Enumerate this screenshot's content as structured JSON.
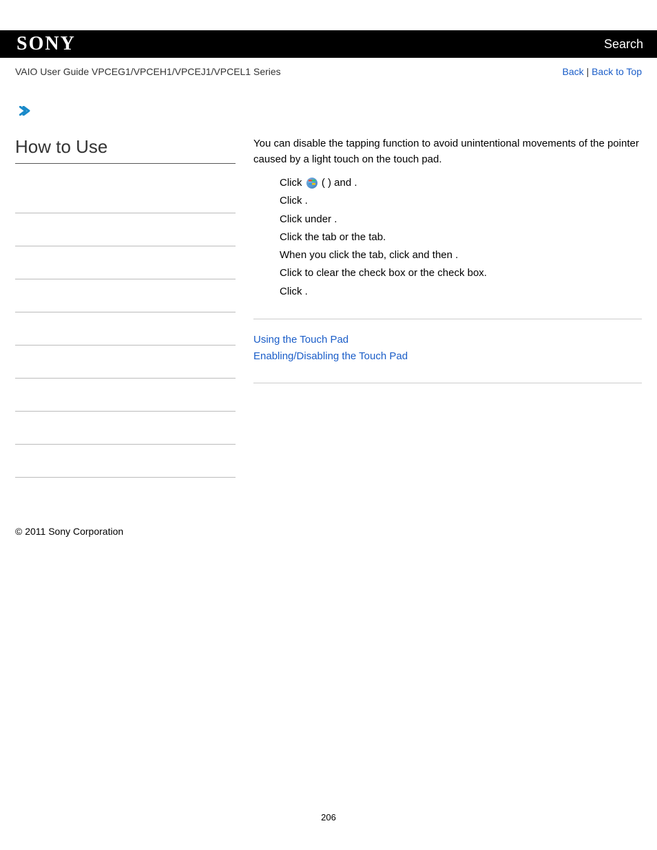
{
  "header": {
    "logo_text": "SONY",
    "search_label": "Search"
  },
  "subbar": {
    "guide_text": "VAIO User Guide VPCEG1/VPCEH1/VPCEJ1/VPCEL1 Series",
    "back_label": "Back",
    "separator": " | ",
    "top_label": "Back to Top"
  },
  "left": {
    "heading": "How to Use"
  },
  "content": {
    "intro": "You can disable the tapping function to avoid unintentional movements of the pointer caused by a light touch on the touch pad.",
    "steps": {
      "s1_a": "Click ",
      "s1_b": " (           ) and                           .",
      "s2": "Click                                              .",
      "s3": "Click                  under                                              .",
      "s4a": "Click the                    tab or the                                  tab.",
      "s4b": "When you click the                                tab, click                    and then           .",
      "s5": "Click to clear the                       check box or the                                check box.",
      "s6": "Click        ."
    },
    "related": {
      "link1": "Using the Touch Pad",
      "link2": "Enabling/Disabling the Touch Pad"
    }
  },
  "footer": {
    "copyright": "© 2011 Sony Corporation",
    "page_number": "206"
  }
}
